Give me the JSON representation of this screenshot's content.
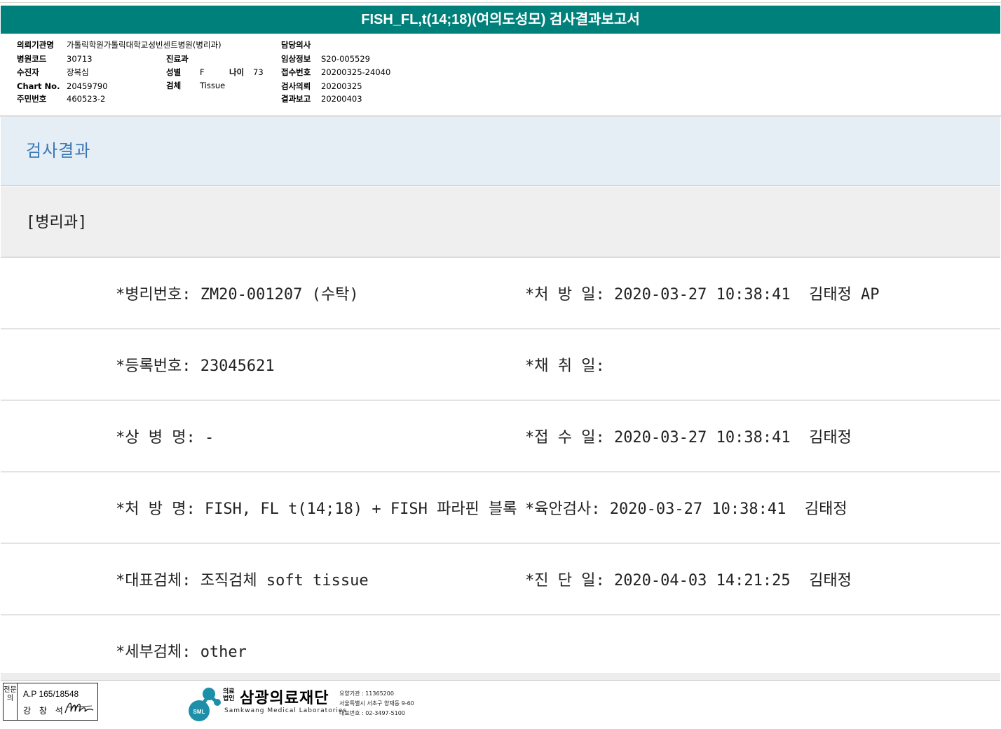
{
  "title": "FISH_FL,t(14;18)(여의도성모) 검사결과보고서",
  "header": {
    "institution_label": "의뢰기관명",
    "institution": "가톨릭학원가톨릭대학교성빈센트병원(병리과)",
    "hospital_code_label": "병원코드",
    "hospital_code": "30713",
    "patient_label": "수진자",
    "patient": "장복심",
    "chart_no_label": "Chart No.",
    "chart_no": "20459790",
    "resident_no_label": "주민번호",
    "resident_no": "460523-2",
    "department_label": "진료과",
    "department": "",
    "sex_label": "성별",
    "sex": "F",
    "age_label": "나이",
    "age": "73",
    "specimen_label": "검체",
    "specimen": "Tissue",
    "doctor_label": "담당의사",
    "doctor": "",
    "clinical_info_label": "임상정보",
    "clinical_info": "S20-005529",
    "receipt_no_label": "접수번호",
    "receipt_no": "20200325-24040",
    "request_label": "검사의뢰",
    "request": "20200325",
    "report_label": "결과보고",
    "report": "20200403"
  },
  "section_title": "검사결과",
  "dept_title": "[병리과]",
  "rows": [
    {
      "left": "*병리번호: ZM20-001207 (수탁)",
      "right": "*처 방 일: 2020-03-27 10:38:41  김태정 AP"
    },
    {
      "left": "*등록번호: 23045621",
      "right": "*채 취 일:"
    },
    {
      "left": "*상 병 명: -",
      "right": "*접 수 일: 2020-03-27 10:38:41  김태정"
    },
    {
      "left": "*처 방 명: FISH, FL t(14;18) + FISH 파라핀 블록",
      "right": "*육안검사: 2020-03-27 10:38:41  김태정"
    },
    {
      "left": "*대표검체: 조직검체 soft tissue",
      "right": "*진 단 일: 2020-04-03 14:21:25  김태정"
    },
    {
      "left": "*세부검체: other",
      "right": ""
    }
  ],
  "footer": {
    "stamp_side": "전문의",
    "stamp_ap": "A.P 165/18548",
    "stamp_name": "강 창 석",
    "logo_small": "의료\n법인",
    "logo_name": "삼광의료재단",
    "logo_en": "Samkwang Medical Laboratories",
    "logo_badge": "SML",
    "info_1": "요양기관 : 11365200",
    "info_2": "서울특별시 서초구 양재동 9-60",
    "info_3": "대표번호 : 02-3497-5100"
  },
  "colors": {
    "title_bar": "#00807a",
    "section_bg": "#e6eef5",
    "section_text": "#3a78b6",
    "dept_bg": "#efefef",
    "logo_teal": "#1e8fa8"
  }
}
